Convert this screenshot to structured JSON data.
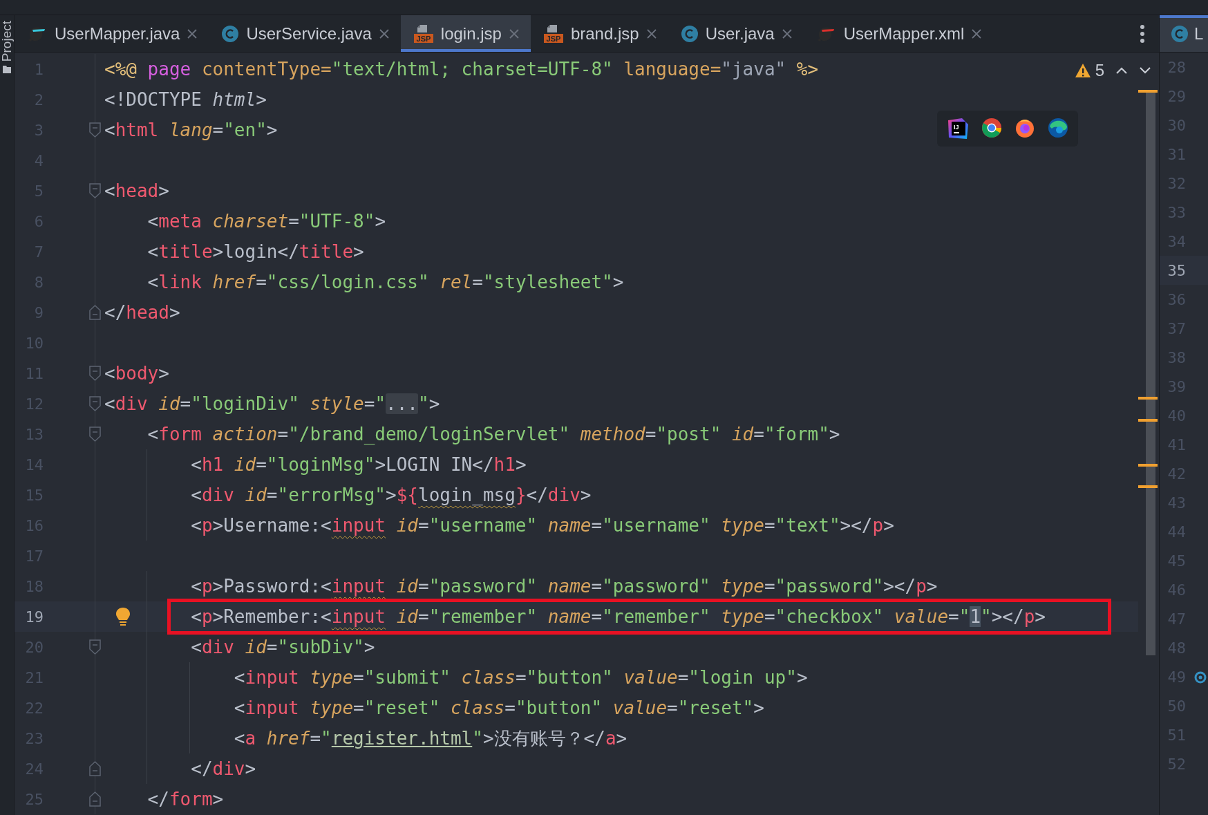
{
  "tool_strip": {
    "label": "Project"
  },
  "tabs": [
    {
      "label": "UserMapper.java",
      "kind": "mybatis-java",
      "selected": false
    },
    {
      "label": "UserService.java",
      "kind": "class",
      "selected": false
    },
    {
      "label": "login.jsp",
      "kind": "jsp",
      "icon_text": "JSP",
      "selected": true
    },
    {
      "label": "brand.jsp",
      "kind": "jsp",
      "icon_text": "JSP",
      "selected": false
    },
    {
      "label": "User.java",
      "kind": "class",
      "selected": false
    },
    {
      "label": "UserMapper.xml",
      "kind": "mybatis-xml",
      "selected": false
    }
  ],
  "inspections": {
    "count": "5"
  },
  "browsers": [
    {
      "kind": "intellij",
      "label": "IJ"
    },
    {
      "kind": "chrome"
    },
    {
      "kind": "firefox"
    },
    {
      "kind": "edge"
    }
  ],
  "code": {
    "lines": [
      {
        "number": "1",
        "current": false,
        "boxed": false,
        "bulb": false,
        "tokens": [
          {
            "kind": "dir",
            "text": "<%@"
          },
          {
            "kind": "kw",
            "text": " page"
          },
          {
            "kind": "key",
            "text": " contentType="
          },
          {
            "kind": "str",
            "text": "\"text/html; charset=UTF-8\""
          },
          {
            "kind": "key",
            "text": " language="
          },
          {
            "kind": "dim",
            "text": "\"java\""
          },
          {
            "kind": "dir",
            "text": " %>"
          }
        ]
      },
      {
        "number": "2",
        "current": false,
        "boxed": false,
        "bulb": false,
        "tokens": [
          {
            "kind": "p",
            "text": "<!DOCTYPE"
          },
          {
            "kind": "em",
            "text": " html"
          },
          {
            "kind": "p",
            "text": ">"
          }
        ]
      },
      {
        "number": "3",
        "fold": {
          "kind": "start"
        },
        "current": false,
        "boxed": false,
        "bulb": false,
        "tokens": [
          {
            "kind": "p",
            "text": "<"
          },
          {
            "kind": "tag",
            "text": "html"
          },
          {
            "kind": "attr",
            "text": " lang"
          },
          {
            "kind": "p",
            "text": "="
          },
          {
            "kind": "str",
            "text": "\"en\""
          },
          {
            "kind": "p",
            "text": ">"
          }
        ]
      },
      {
        "number": "4",
        "current": false,
        "boxed": false,
        "bulb": false
      },
      {
        "number": "5",
        "fold": {
          "kind": "start"
        },
        "current": false,
        "boxed": false,
        "bulb": false,
        "tokens": [
          {
            "kind": "p",
            "text": "<"
          },
          {
            "kind": "tag",
            "text": "head"
          },
          {
            "kind": "p",
            "text": ">"
          }
        ]
      },
      {
        "number": "6",
        "current": false,
        "boxed": false,
        "bulb": false,
        "tokens": [
          {
            "kind": "p",
            "text": "    <"
          },
          {
            "kind": "tag",
            "text": "meta"
          },
          {
            "kind": "attr",
            "text": " charset"
          },
          {
            "kind": "p",
            "text": "="
          },
          {
            "kind": "str",
            "text": "\"UTF-8\""
          },
          {
            "kind": "p",
            "text": ">"
          }
        ]
      },
      {
        "number": "7",
        "current": false,
        "boxed": false,
        "bulb": false,
        "tokens": [
          {
            "kind": "p",
            "text": "    <"
          },
          {
            "kind": "tag",
            "text": "title"
          },
          {
            "kind": "p",
            "text": ">"
          },
          {
            "kind": "p",
            "text": "login"
          },
          {
            "kind": "p",
            "text": "</"
          },
          {
            "kind": "tag",
            "text": "title"
          },
          {
            "kind": "p",
            "text": ">"
          }
        ]
      },
      {
        "number": "8",
        "current": false,
        "boxed": false,
        "bulb": false,
        "tokens": [
          {
            "kind": "p",
            "text": "    <"
          },
          {
            "kind": "tag",
            "text": "link"
          },
          {
            "kind": "attr",
            "text": " href"
          },
          {
            "kind": "p",
            "text": "="
          },
          {
            "kind": "str",
            "text": "\"css/login.css\""
          },
          {
            "kind": "attr",
            "text": " rel"
          },
          {
            "kind": "p",
            "text": "="
          },
          {
            "kind": "str",
            "text": "\"stylesheet\""
          },
          {
            "kind": "p",
            "text": ">"
          }
        ]
      },
      {
        "number": "9",
        "fold": {
          "kind": "end"
        },
        "current": false,
        "boxed": false,
        "bulb": false,
        "tokens": [
          {
            "kind": "p",
            "text": "</"
          },
          {
            "kind": "tag",
            "text": "head"
          },
          {
            "kind": "p",
            "text": ">"
          }
        ]
      },
      {
        "number": "10",
        "current": false,
        "boxed": false,
        "bulb": false
      },
      {
        "number": "11",
        "fold": {
          "kind": "start"
        },
        "current": false,
        "boxed": false,
        "bulb": false,
        "tokens": [
          {
            "kind": "p",
            "text": "<"
          },
          {
            "kind": "tag",
            "text": "body"
          },
          {
            "kind": "p",
            "text": ">"
          }
        ]
      },
      {
        "number": "12",
        "fold": {
          "kind": "start"
        },
        "current": false,
        "boxed": false,
        "bulb": false,
        "tokens": [
          {
            "kind": "p",
            "text": "<"
          },
          {
            "kind": "tag",
            "text": "div"
          },
          {
            "kind": "attr",
            "text": " id"
          },
          {
            "kind": "p",
            "text": "="
          },
          {
            "kind": "str",
            "text": "\"loginDiv\""
          },
          {
            "kind": "attr",
            "text": " style"
          },
          {
            "kind": "p",
            "text": "="
          },
          {
            "kind": "str",
            "text": "\""
          },
          {
            "kind": "fold",
            "text": "..."
          },
          {
            "kind": "str",
            "text": "\""
          },
          {
            "kind": "p",
            "text": ">"
          }
        ]
      },
      {
        "number": "13",
        "fold": {
          "kind": "start"
        },
        "current": false,
        "boxed": false,
        "bulb": false,
        "tokens": [
          {
            "kind": "p",
            "text": "    <"
          },
          {
            "kind": "tag",
            "text": "form"
          },
          {
            "kind": "attr",
            "text": " action"
          },
          {
            "kind": "p",
            "text": "="
          },
          {
            "kind": "str",
            "text": "\"/brand_demo/loginServlet\""
          },
          {
            "kind": "attr",
            "text": " method"
          },
          {
            "kind": "p",
            "text": "="
          },
          {
            "kind": "str",
            "text": "\"post\""
          },
          {
            "kind": "attr",
            "text": " id"
          },
          {
            "kind": "p",
            "text": "="
          },
          {
            "kind": "str",
            "text": "\"form\""
          },
          {
            "kind": "p",
            "text": ">"
          }
        ]
      },
      {
        "number": "14",
        "current": false,
        "boxed": false,
        "bulb": false,
        "tokens": [
          {
            "kind": "p",
            "text": "        <"
          },
          {
            "kind": "tag",
            "text": "h1"
          },
          {
            "kind": "attr",
            "text": " id"
          },
          {
            "kind": "p",
            "text": "="
          },
          {
            "kind": "str",
            "text": "\"loginMsg\""
          },
          {
            "kind": "p",
            "text": ">LOGIN IN</"
          },
          {
            "kind": "tag",
            "text": "h1"
          },
          {
            "kind": "p",
            "text": ">"
          }
        ]
      },
      {
        "number": "15",
        "current": false,
        "boxed": false,
        "bulb": false,
        "tokens": [
          {
            "kind": "p",
            "text": "        <"
          },
          {
            "kind": "tag",
            "text": "div"
          },
          {
            "kind": "attr",
            "text": " id"
          },
          {
            "kind": "p",
            "text": "="
          },
          {
            "kind": "str",
            "text": "\"errorMsg\""
          },
          {
            "kind": "p",
            "text": ">"
          },
          {
            "kind": "tag",
            "text": "${"
          },
          {
            "kind": "warn-txt",
            "text": "login_msg"
          },
          {
            "kind": "tag",
            "text": "}"
          },
          {
            "kind": "p",
            "text": "</"
          },
          {
            "kind": "tag",
            "text": "div"
          },
          {
            "kind": "p",
            "text": ">"
          }
        ]
      },
      {
        "number": "16",
        "current": false,
        "boxed": false,
        "bulb": false,
        "tokens": [
          {
            "kind": "p",
            "text": "        <"
          },
          {
            "kind": "tag",
            "text": "p"
          },
          {
            "kind": "p",
            "text": ">Username:<"
          },
          {
            "kind": "warn-tag",
            "text": "input"
          },
          {
            "kind": "attr",
            "text": " id"
          },
          {
            "kind": "p",
            "text": "="
          },
          {
            "kind": "str",
            "text": "\"username\""
          },
          {
            "kind": "attr",
            "text": " name"
          },
          {
            "kind": "p",
            "text": "="
          },
          {
            "kind": "str",
            "text": "\"username\""
          },
          {
            "kind": "attr",
            "text": " type"
          },
          {
            "kind": "p",
            "text": "="
          },
          {
            "kind": "str",
            "text": "\"text\""
          },
          {
            "kind": "p",
            "text": "></"
          },
          {
            "kind": "tag",
            "text": "p"
          },
          {
            "kind": "p",
            "text": ">"
          }
        ]
      },
      {
        "number": "17",
        "current": false,
        "boxed": false,
        "bulb": false
      },
      {
        "number": "18",
        "current": false,
        "boxed": false,
        "bulb": false,
        "tokens": [
          {
            "kind": "p",
            "text": "        <"
          },
          {
            "kind": "tag",
            "text": "p"
          },
          {
            "kind": "p",
            "text": ">Password:<"
          },
          {
            "kind": "warn-tag",
            "text": "input"
          },
          {
            "kind": "attr",
            "text": " id"
          },
          {
            "kind": "p",
            "text": "="
          },
          {
            "kind": "str",
            "text": "\"password\""
          },
          {
            "kind": "attr",
            "text": " name"
          },
          {
            "kind": "p",
            "text": "="
          },
          {
            "kind": "str",
            "text": "\"password\""
          },
          {
            "kind": "attr",
            "text": " type"
          },
          {
            "kind": "p",
            "text": "="
          },
          {
            "kind": "str",
            "text": "\"password\""
          },
          {
            "kind": "p",
            "text": "></"
          },
          {
            "kind": "tag",
            "text": "p"
          },
          {
            "kind": "p",
            "text": ">"
          }
        ]
      },
      {
        "number": "19",
        "current": true,
        "boxed": true,
        "bulb": true,
        "tokens": [
          {
            "kind": "p",
            "text": "        <"
          },
          {
            "kind": "tag",
            "text": "p"
          },
          {
            "kind": "p",
            "text": ">Remember:<"
          },
          {
            "kind": "warn-tag",
            "text": "input"
          },
          {
            "kind": "attr",
            "text": " id"
          },
          {
            "kind": "p",
            "text": "="
          },
          {
            "kind": "str",
            "text": "\"remember\""
          },
          {
            "kind": "attr",
            "text": " name"
          },
          {
            "kind": "p",
            "text": "="
          },
          {
            "kind": "str",
            "text": "\"remember\""
          },
          {
            "kind": "attr",
            "text": " type"
          },
          {
            "kind": "p",
            "text": "="
          },
          {
            "kind": "str",
            "text": "\"checkbox\""
          },
          {
            "kind": "attr",
            "text": " value"
          },
          {
            "kind": "p",
            "text": "="
          },
          {
            "kind": "str",
            "text": "\""
          },
          {
            "kind": "match",
            "text": "1"
          },
          {
            "kind": "str",
            "text": "\""
          },
          {
            "kind": "p",
            "text": "></"
          },
          {
            "kind": "tag",
            "text": "p"
          },
          {
            "kind": "p",
            "text": ">"
          }
        ]
      },
      {
        "number": "20",
        "fold": {
          "kind": "start"
        },
        "current": false,
        "boxed": false,
        "bulb": false,
        "tokens": [
          {
            "kind": "p",
            "text": "        <"
          },
          {
            "kind": "tag",
            "text": "div"
          },
          {
            "kind": "attr",
            "text": " id"
          },
          {
            "kind": "p",
            "text": "="
          },
          {
            "kind": "str",
            "text": "\"subDiv\""
          },
          {
            "kind": "p",
            "text": ">"
          }
        ]
      },
      {
        "number": "21",
        "current": false,
        "boxed": false,
        "bulb": false,
        "tokens": [
          {
            "kind": "p",
            "text": "            <"
          },
          {
            "kind": "tag",
            "text": "input"
          },
          {
            "kind": "attr",
            "text": " type"
          },
          {
            "kind": "p",
            "text": "="
          },
          {
            "kind": "str",
            "text": "\"submit\""
          },
          {
            "kind": "attr",
            "text": " class"
          },
          {
            "kind": "p",
            "text": "="
          },
          {
            "kind": "str",
            "text": "\"button\""
          },
          {
            "kind": "attr",
            "text": " value"
          },
          {
            "kind": "p",
            "text": "="
          },
          {
            "kind": "str",
            "text": "\"login up\""
          },
          {
            "kind": "p",
            "text": ">"
          }
        ]
      },
      {
        "number": "22",
        "current": false,
        "boxed": false,
        "bulb": false,
        "tokens": [
          {
            "kind": "p",
            "text": "            <"
          },
          {
            "kind": "tag",
            "text": "input"
          },
          {
            "kind": "attr",
            "text": " type"
          },
          {
            "kind": "p",
            "text": "="
          },
          {
            "kind": "str",
            "text": "\"reset\""
          },
          {
            "kind": "attr",
            "text": " class"
          },
          {
            "kind": "p",
            "text": "="
          },
          {
            "kind": "str",
            "text": "\"button\""
          },
          {
            "kind": "attr",
            "text": " value"
          },
          {
            "kind": "p",
            "text": "="
          },
          {
            "kind": "str",
            "text": "\"reset\""
          },
          {
            "kind": "p",
            "text": ">"
          }
        ]
      },
      {
        "number": "23",
        "current": false,
        "boxed": false,
        "bulb": false,
        "tokens": [
          {
            "kind": "p",
            "text": "            <"
          },
          {
            "kind": "tag",
            "text": "a"
          },
          {
            "kind": "attr",
            "text": " href"
          },
          {
            "kind": "p",
            "text": "="
          },
          {
            "kind": "str",
            "text": "\""
          },
          {
            "kind": "link",
            "text": "register.html"
          },
          {
            "kind": "str",
            "text": "\""
          },
          {
            "kind": "p",
            "text": ">没有账号？</"
          },
          {
            "kind": "tag",
            "text": "a"
          },
          {
            "kind": "p",
            "text": ">"
          }
        ]
      },
      {
        "number": "24",
        "fold": {
          "kind": "end"
        },
        "current": false,
        "boxed": false,
        "bulb": false,
        "tokens": [
          {
            "kind": "p",
            "text": "        </"
          },
          {
            "kind": "tag",
            "text": "div"
          },
          {
            "kind": "p",
            "text": ">"
          }
        ]
      },
      {
        "number": "25",
        "fold": {
          "kind": "end"
        },
        "current": false,
        "boxed": false,
        "bulb": false,
        "tokens": [
          {
            "kind": "p",
            "text": "    </"
          },
          {
            "kind": "tag",
            "text": "form"
          },
          {
            "kind": "p",
            "text": ">"
          }
        ]
      }
    ]
  },
  "right_pane": {
    "tab": {
      "label": "L",
      "kind": "class",
      "selected": true
    },
    "lines": [
      {
        "number": "28",
        "current": false,
        "marker": false
      },
      {
        "number": "29",
        "current": false,
        "marker": false
      },
      {
        "number": "30",
        "current": false,
        "marker": false
      },
      {
        "number": "31",
        "current": false,
        "marker": false
      },
      {
        "number": "32",
        "current": false,
        "marker": false
      },
      {
        "number": "33",
        "current": false,
        "marker": false
      },
      {
        "number": "34",
        "current": false,
        "marker": false
      },
      {
        "number": "35",
        "current": true,
        "marker": false
      },
      {
        "number": "36",
        "current": false,
        "marker": false
      },
      {
        "number": "37",
        "current": false,
        "marker": false
      },
      {
        "number": "38",
        "current": false,
        "marker": false
      },
      {
        "number": "39",
        "current": false,
        "marker": false
      },
      {
        "number": "40",
        "current": false,
        "marker": false
      },
      {
        "number": "41",
        "current": false,
        "marker": false
      },
      {
        "number": "42",
        "current": false,
        "marker": false
      },
      {
        "number": "43",
        "current": false,
        "marker": false
      },
      {
        "number": "44",
        "current": false,
        "marker": false
      },
      {
        "number": "45",
        "current": false,
        "marker": false
      },
      {
        "number": "46",
        "current": false,
        "marker": false
      },
      {
        "number": "47",
        "current": false,
        "marker": false
      },
      {
        "number": "48",
        "current": false,
        "marker": false
      },
      {
        "number": "49",
        "current": false,
        "marker": true
      },
      {
        "number": "50",
        "current": false,
        "marker": false
      },
      {
        "number": "51",
        "current": false,
        "marker": false
      },
      {
        "number": "52",
        "current": false,
        "marker": false
      }
    ]
  }
}
